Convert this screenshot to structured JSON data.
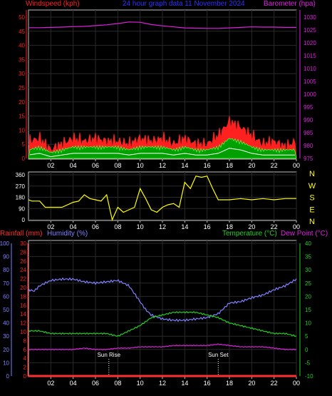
{
  "header": {
    "left_title": "Windspeed (kph)",
    "center_title": "24 hour graph data   11 November 2024",
    "right_title": "Barometer (hpa)"
  },
  "colors": {
    "wind": "#ff2020",
    "wind_gust_fill": "#00a000",
    "wind_avg": "#ffffff",
    "barometer": "#e020e0",
    "direction": "#ffff00",
    "rain": "#ff3030",
    "humidity": "#8080ff",
    "temperature": "#20d020",
    "dewpoint": "#e020e0",
    "axis_red": "#ff2020",
    "axis_magenta": "#e020e0",
    "axis_blue": "#8080ff",
    "axis_green": "#20d020",
    "grid": "#2a2a2a",
    "frame": "#c0c0c0"
  },
  "chart_data": [
    {
      "type": "line",
      "panel": "wind_baro",
      "title": "24 hour graph data   11 November 2024",
      "x": [
        0,
        24
      ],
      "xticks": [
        "02",
        "04",
        "06",
        "08",
        "10",
        "12",
        "14",
        "16",
        "18",
        "20",
        "22",
        "00"
      ],
      "left_axis": {
        "label": "Windspeed (kph)",
        "ylim": [
          0,
          50
        ],
        "ticks": [
          0,
          5,
          10,
          15,
          20,
          25,
          30,
          35,
          40,
          45,
          50
        ]
      },
      "right_axis": {
        "label": "Barometer (hpa)",
        "ylim": [
          975,
          1030
        ],
        "ticks": [
          975,
          980,
          985,
          990,
          995,
          1000,
          1005,
          1010,
          1015,
          1020,
          1025,
          1030
        ]
      },
      "series": [
        {
          "name": "Barometer (hpa)",
          "axis": "right",
          "x": [
            0,
            1,
            2,
            3,
            4,
            5,
            6,
            7,
            8,
            9,
            10,
            11,
            12,
            13,
            14,
            15,
            16,
            17,
            18,
            19,
            20,
            21,
            22,
            23,
            24
          ],
          "values": [
            1025.9,
            1025.9,
            1026.0,
            1026.1,
            1026.3,
            1026.4,
            1026.7,
            1027.0,
            1027.5,
            1028.1,
            1028.0,
            1027.1,
            1026.6,
            1026.2,
            1025.8,
            1025.7,
            1025.6,
            1025.6,
            1025.8,
            1026.0,
            1026.2,
            1026.1,
            1026.1,
            1026.0,
            1026.0
          ]
        },
        {
          "name": "Wind gust",
          "axis": "left",
          "x": [
            0,
            1,
            2,
            3,
            4,
            5,
            6,
            7,
            8,
            9,
            10,
            11,
            12,
            13,
            14,
            15,
            16,
            17,
            18,
            19,
            20,
            21,
            22,
            23,
            24
          ],
          "values": [
            6,
            7,
            3,
            5,
            7,
            6,
            7,
            6,
            6,
            5,
            7,
            6,
            7,
            5,
            7,
            5,
            5,
            8,
            13,
            11,
            8,
            5,
            6,
            4,
            6
          ]
        },
        {
          "name": "Wind average",
          "axis": "left",
          "x": [
            0,
            1,
            2,
            3,
            4,
            5,
            6,
            7,
            8,
            9,
            10,
            11,
            12,
            13,
            14,
            15,
            16,
            17,
            18,
            19,
            20,
            21,
            22,
            23,
            24
          ],
          "values": [
            2,
            3,
            1,
            2,
            3,
            3,
            3,
            3,
            3,
            2,
            3,
            3,
            3,
            2,
            3,
            2,
            2,
            3,
            6,
            5,
            3,
            2,
            2,
            2,
            2
          ]
        }
      ]
    },
    {
      "type": "line",
      "panel": "direction",
      "x": [
        0,
        24
      ],
      "xticks": [
        "02",
        "04",
        "06",
        "08",
        "10",
        "12",
        "14",
        "16",
        "18",
        "20",
        "22",
        "00"
      ],
      "left_axis": {
        "ylim": [
          0,
          360
        ],
        "ticks": [
          0,
          90,
          180,
          270,
          360
        ]
      },
      "right_axis": {
        "ticks": [
          "N",
          "W",
          "S",
          "E",
          "N"
        ]
      },
      "series": [
        {
          "name": "Wind direction",
          "x": [
            0,
            0.3,
            1,
            1.5,
            2,
            3,
            4,
            4.5,
            5,
            5.5,
            6,
            6.5,
            7,
            7.5,
            8,
            8.5,
            9,
            9.5,
            10,
            10.5,
            11,
            11.5,
            12,
            12.5,
            13,
            13.5,
            14,
            14.5,
            15,
            15.5,
            16,
            16.5,
            17,
            18,
            19,
            20,
            21,
            22,
            23,
            24
          ],
          "values": [
            160,
            150,
            150,
            100,
            100,
            100,
            140,
            150,
            200,
            170,
            160,
            150,
            200,
            0,
            100,
            60,
            80,
            100,
            250,
            170,
            80,
            60,
            100,
            120,
            130,
            100,
            300,
            250,
            350,
            340,
            350,
            250,
            160,
            160,
            170,
            160,
            170,
            160,
            170,
            170
          ]
        }
      ]
    },
    {
      "type": "line",
      "panel": "temp_hum",
      "x": [
        0,
        24
      ],
      "xticks": [
        "02",
        "04",
        "06",
        "08",
        "10",
        "12",
        "14",
        "16",
        "18",
        "20",
        "22",
        "00"
      ],
      "axes": [
        {
          "label": "Rainfall (mm)",
          "ylim": [
            0,
            30
          ],
          "ticks": [
            0,
            2,
            4,
            6,
            8,
            10,
            12,
            14,
            16,
            18,
            20,
            22,
            24,
            26,
            28,
            30
          ]
        },
        {
          "label": "Humidity (%)",
          "ylim": [
            0,
            100
          ],
          "ticks": [
            0,
            10,
            20,
            30,
            40,
            50,
            60,
            70,
            80,
            90,
            100
          ]
        },
        {
          "label": "Temperature (°C)",
          "ylim": [
            -10,
            40
          ],
          "ticks": [
            -10,
            -5,
            0,
            5,
            10,
            15,
            20,
            25,
            30,
            35,
            40
          ]
        },
        {
          "label": "Dew Point (°C)"
        }
      ],
      "annotations": [
        {
          "text": "Sun Rise",
          "x": 7.2
        },
        {
          "text": "Sun Set",
          "x": 17.0
        }
      ],
      "series": [
        {
          "name": "Humidity (%)",
          "axis": "humidity",
          "x": [
            0,
            0.5,
            1,
            1.5,
            2,
            3,
            4,
            5,
            6,
            7,
            8,
            9,
            10,
            10.5,
            11,
            12,
            13,
            14,
            15,
            16,
            17,
            18,
            19,
            20,
            21,
            22,
            23,
            24
          ],
          "values": [
            65,
            64,
            68,
            70,
            72,
            73,
            73,
            71,
            70,
            71,
            72,
            68,
            56,
            50,
            46,
            43,
            42,
            42,
            43,
            44,
            47,
            55,
            56,
            59,
            61,
            65,
            68,
            73
          ]
        },
        {
          "name": "Temperature (°C)",
          "axis": "temperature",
          "x": [
            0,
            1,
            2,
            3,
            4,
            5,
            6,
            7,
            8,
            9,
            10,
            11,
            12,
            13,
            14,
            15,
            16,
            17,
            18,
            19,
            20,
            21,
            22,
            23,
            24
          ],
          "values": [
            7,
            7,
            6,
            6,
            6,
            6,
            6,
            6,
            5,
            7,
            9,
            12,
            13,
            14,
            14,
            14,
            13,
            12,
            10,
            9,
            8,
            7,
            6,
            6,
            5
          ]
        },
        {
          "name": "Dew Point (°C)",
          "axis": "temperature",
          "x": [
            0,
            1,
            2,
            3,
            4,
            5,
            6,
            7,
            8,
            9,
            10,
            11,
            12,
            13,
            14,
            15,
            16,
            17,
            18,
            19,
            20,
            21,
            22,
            23,
            24
          ],
          "values": [
            0,
            0,
            0,
            0,
            0,
            0.5,
            0,
            0,
            0.5,
            0.5,
            1,
            1,
            1,
            1.5,
            1.5,
            1.5,
            1.5,
            2,
            1.5,
            1,
            1,
            1,
            0.5,
            0,
            0
          ]
        },
        {
          "name": "Rainfall (mm)",
          "axis": "rain",
          "x": [
            0,
            24
          ],
          "values": [
            0,
            0
          ]
        }
      ]
    }
  ]
}
